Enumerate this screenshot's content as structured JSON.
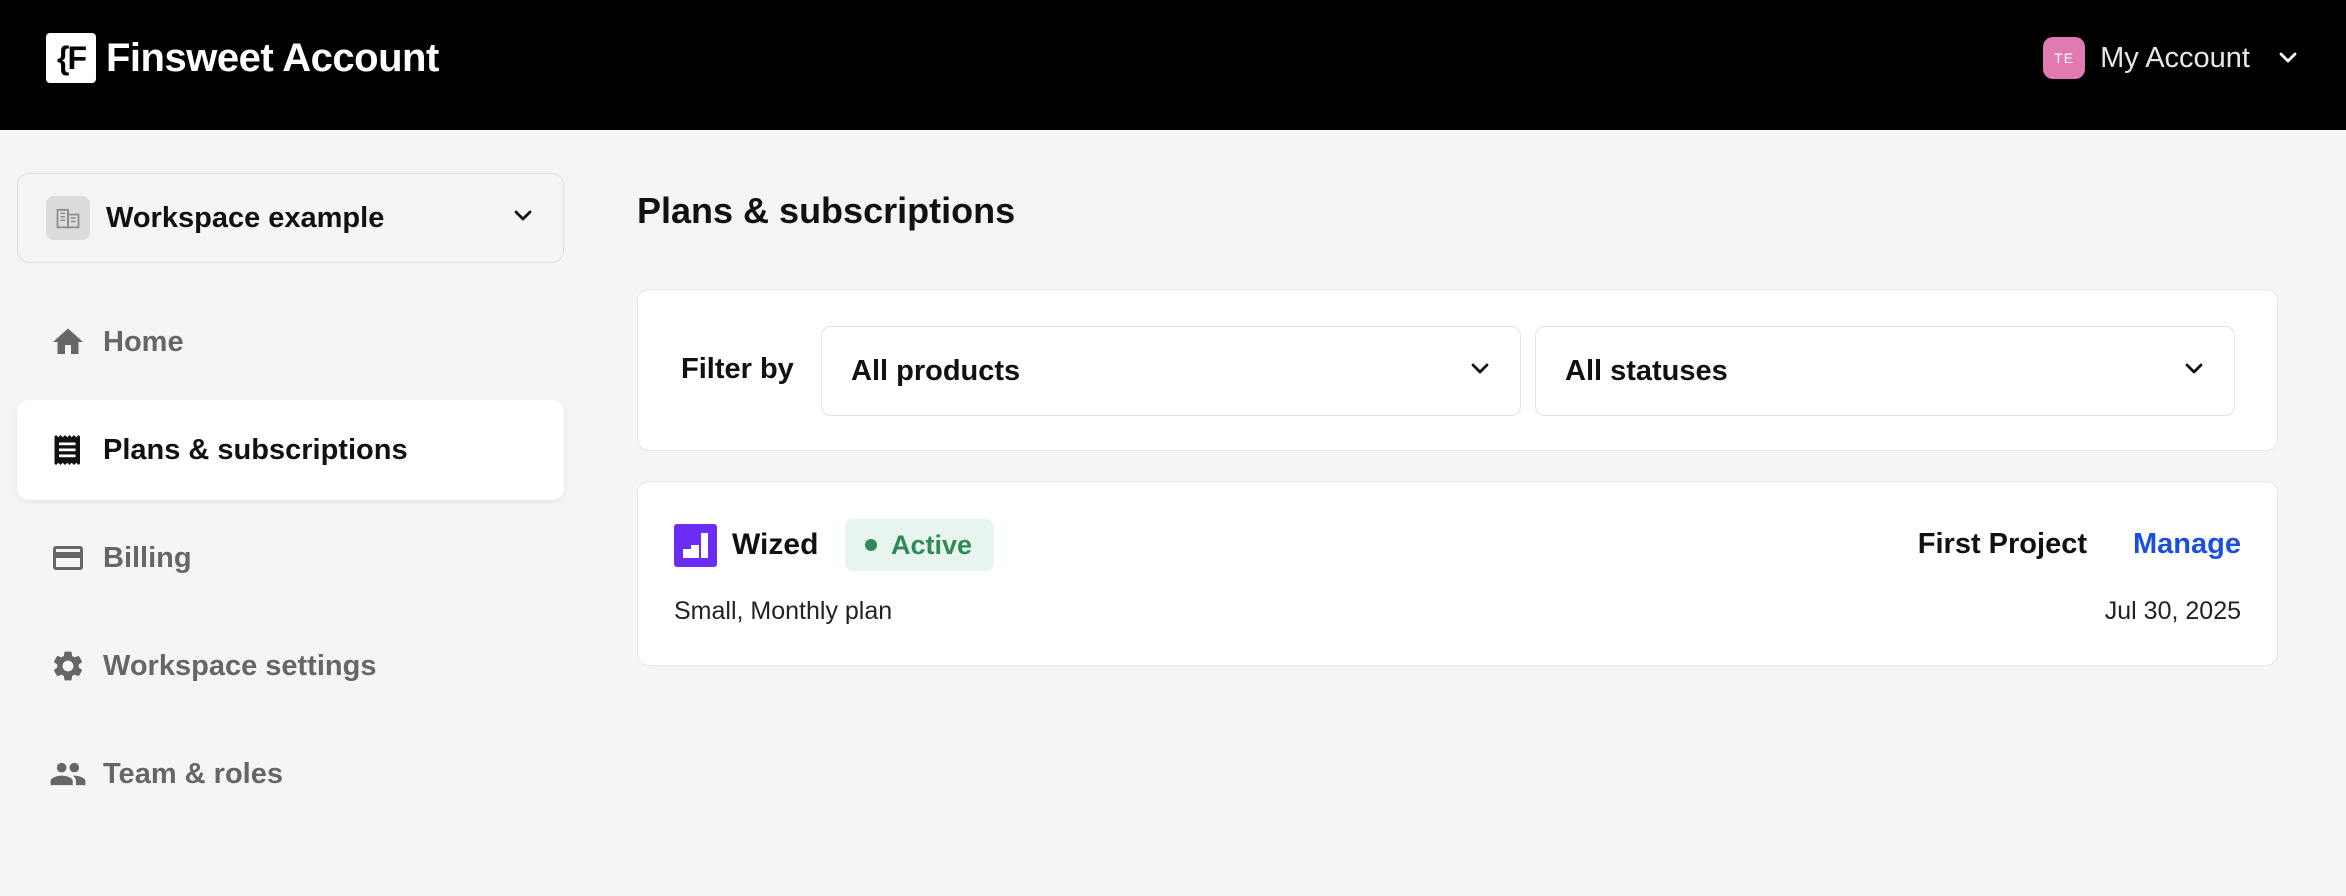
{
  "header": {
    "brand_logo_text": "{F",
    "brand_name": "Finsweet Account",
    "avatar_initials": "TE",
    "account_label": "My Account"
  },
  "sidebar": {
    "workspace_label": "Workspace example",
    "items": [
      {
        "label": "Home",
        "icon": "home-icon",
        "active": false
      },
      {
        "label": "Plans & subscriptions",
        "icon": "receipt-icon",
        "active": true
      },
      {
        "label": "Billing",
        "icon": "credit-card-icon",
        "active": false
      },
      {
        "label": "Workspace settings",
        "icon": "gear-icon",
        "active": false
      },
      {
        "label": "Team & roles",
        "icon": "people-icon",
        "active": false
      }
    ]
  },
  "main": {
    "title": "Plans & subscriptions",
    "filters": {
      "label": "Filter by",
      "product_value": "All products",
      "status_value": "All statuses"
    },
    "subscriptions": [
      {
        "product": "Wized",
        "status": "Active",
        "project": "First Project",
        "action": "Manage",
        "plan": "Small, Monthly plan",
        "date": "Jul 30, 2025"
      }
    ]
  },
  "colors": {
    "topbar": "#000000",
    "avatar": "#e27ab2",
    "active_status": "#2f8a57",
    "active_badge_bg": "#e8f5ee",
    "link": "#1a4fe0",
    "product_logo": "#6b2cf5"
  }
}
